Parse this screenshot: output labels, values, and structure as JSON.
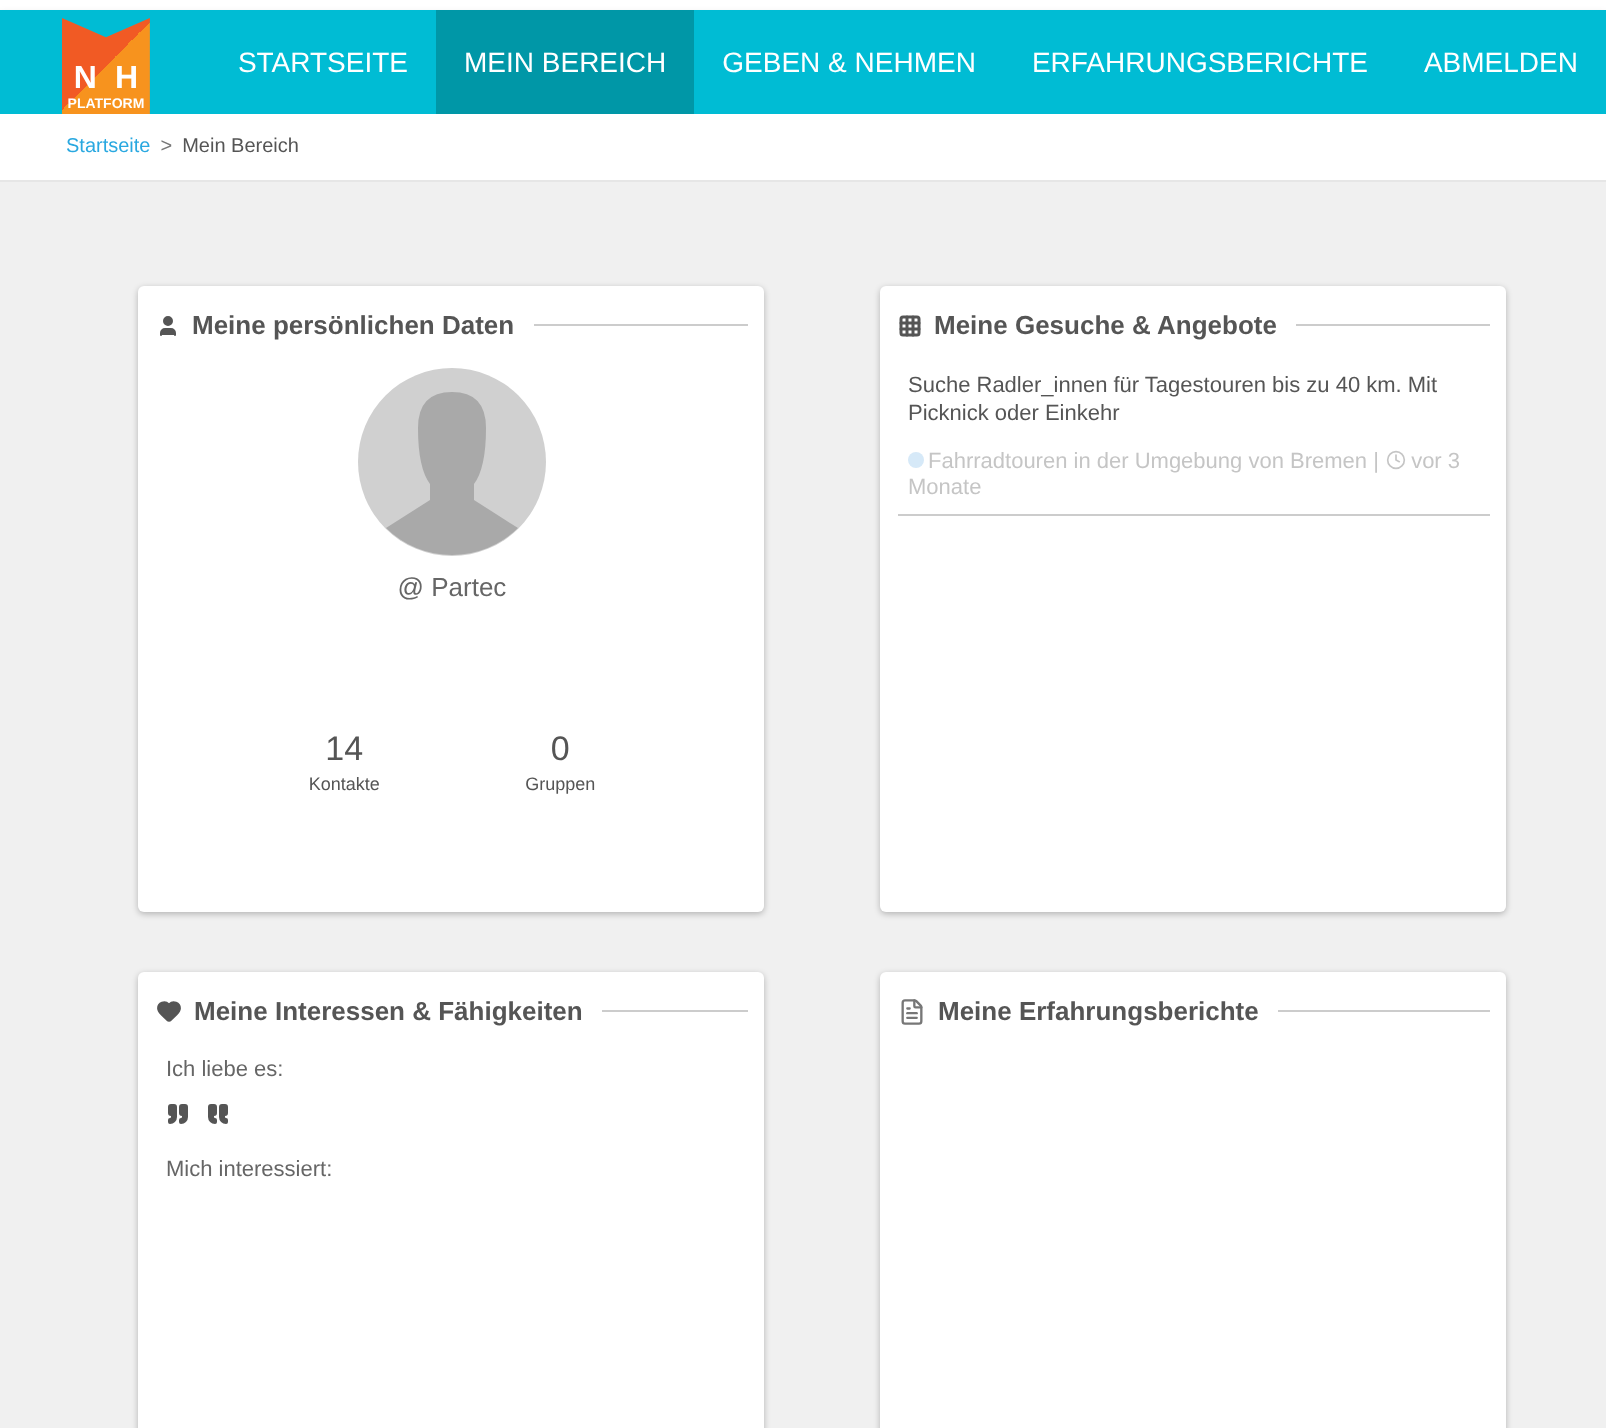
{
  "logo": {
    "letters": [
      "N",
      "H"
    ],
    "caption": "PLATFORM"
  },
  "nav": [
    {
      "label": "STARTSEITE",
      "selected": false
    },
    {
      "label": "MEIN BEREICH",
      "selected": true
    },
    {
      "label": "GEBEN & NEHMEN",
      "selected": false
    },
    {
      "label": "ERFAHRUNGSBERICHTE",
      "selected": false
    },
    {
      "label": "ABMELDEN",
      "selected": false
    }
  ],
  "breadcrumb": {
    "link": "Startseite",
    "separator": ">",
    "current": "Mein Bereich"
  },
  "cards": [
    {
      "kind": "profile",
      "title": "Meine persönlichen Daten",
      "username": "@ Partec",
      "stats": [
        {
          "value": "14",
          "label": "Kontakte"
        },
        {
          "value": "0",
          "label": "Gruppen"
        }
      ]
    },
    {
      "kind": "offers",
      "title": "Meine Gesuche & Angebote",
      "items": [
        {
          "text": "Suche Radler_innen für Tagestouren bis zu 40 km. Mit Picknick oder Einkehr",
          "category": "Fahrradtouren in der Umgebung von Bremen |",
          "time": "vor 3 Monate"
        }
      ]
    },
    {
      "kind": "interests",
      "title": "Meine Interessen & Fähigkeiten",
      "love_label": "Ich liebe es:",
      "interest_label": "Mich interessiert:"
    },
    {
      "kind": "reports",
      "title": "Meine Erfahrungsberichte"
    }
  ]
}
